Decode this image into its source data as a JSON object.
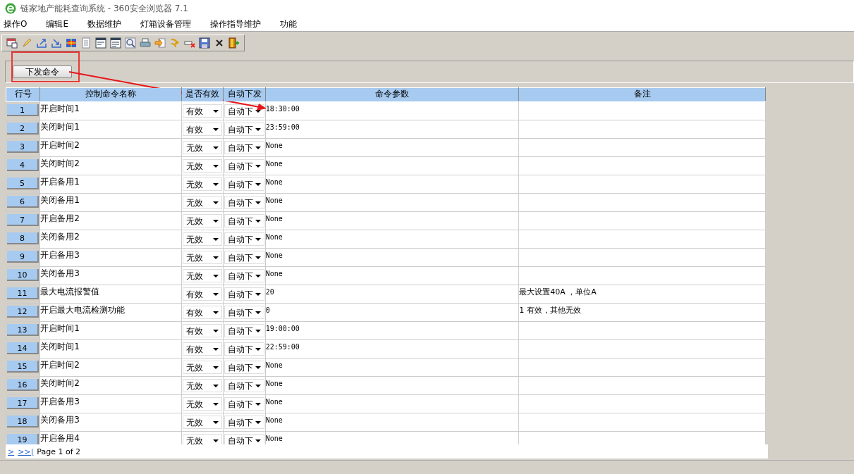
{
  "window": {
    "title": "链家地产能耗查询系统 - 360安全浏览器 7.1"
  },
  "menu": [
    "操作O",
    "编辑E",
    "数据维护",
    "灯箱设备管理",
    "操作指导维护",
    "功能"
  ],
  "command_button": "下发命令",
  "table": {
    "columns": [
      "行号",
      "控制命令名称",
      "是否有效",
      "自动下发",
      "命令参数",
      "备注"
    ],
    "rows": [
      {
        "no": "1",
        "name": "开启时间1",
        "valid": "有效",
        "auto": "自动下",
        "param": "18:30:00"
      },
      {
        "no": "2",
        "name": "关闭时间1",
        "valid": "有效",
        "auto": "自动下",
        "param": "23:59:00"
      },
      {
        "no": "3",
        "name": "开启时间2",
        "valid": "无效",
        "auto": "自动下",
        "param": "None"
      },
      {
        "no": "4",
        "name": "关闭时间2",
        "valid": "无效",
        "auto": "自动下",
        "param": "None"
      },
      {
        "no": "5",
        "name": "开启备用1",
        "valid": "无效",
        "auto": "自动下",
        "param": "None"
      },
      {
        "no": "6",
        "name": "关闭备用1",
        "valid": "无效",
        "auto": "自动下",
        "param": "None"
      },
      {
        "no": "7",
        "name": "开启备用2",
        "valid": "无效",
        "auto": "自动下",
        "param": "None"
      },
      {
        "no": "8",
        "name": "关闭备用2",
        "valid": "无效",
        "auto": "自动下",
        "param": "None"
      },
      {
        "no": "9",
        "name": "开启备用3",
        "valid": "无效",
        "auto": "自动下",
        "param": "None"
      },
      {
        "no": "10",
        "name": "关闭备用3",
        "valid": "无效",
        "auto": "自动下",
        "param": "None"
      },
      {
        "no": "11",
        "name": "最大电流报警值",
        "valid": "有效",
        "auto": "自动下",
        "param": "20",
        "note": "最大设置40A ，单位A"
      },
      {
        "no": "12",
        "name": "开启最大电流检测功能",
        "valid": "有效",
        "auto": "自动下",
        "param": "0",
        "note": "1 有效，其他无效"
      },
      {
        "no": "13",
        "name": "开启时间1",
        "valid": "有效",
        "auto": "自动下",
        "param": "19:00:00"
      },
      {
        "no": "14",
        "name": "关闭时间1",
        "valid": "有效",
        "auto": "自动下",
        "param": "22:59:00"
      },
      {
        "no": "15",
        "name": "开启时间2",
        "valid": "无效",
        "auto": "自动下",
        "param": "None"
      },
      {
        "no": "16",
        "name": "关闭时间2",
        "valid": "无效",
        "auto": "自动下",
        "param": "None"
      },
      {
        "no": "17",
        "name": "开启备用3",
        "valid": "无效",
        "auto": "自动下",
        "param": "None"
      },
      {
        "no": "18",
        "name": "关闭备用3",
        "valid": "无效",
        "auto": "自动下",
        "param": "None"
      },
      {
        "no": "19",
        "name": "开启备用4",
        "valid": "无效",
        "auto": "自动下",
        "param": "None"
      }
    ]
  },
  "pager": {
    "next": ">",
    "last": ">>|",
    "info": "Page 1 of 2"
  }
}
